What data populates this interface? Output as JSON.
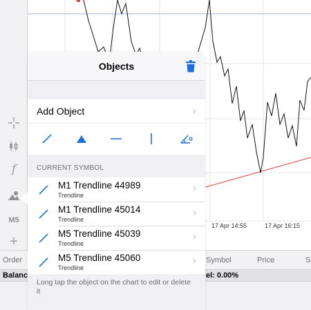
{
  "colors": {
    "accent": "#1a6fe0",
    "trendline": "#e53935"
  },
  "toolbar": {
    "icons": [
      "crosshair-icon",
      "candles-icon",
      "indicators-icon",
      "objects-icon"
    ],
    "indicators_glyph": "f",
    "timeframe": "M5",
    "add_glyph": "+"
  },
  "chart": {
    "time_labels": [
      "17 Apr 14:55",
      "17 Apr 16:15"
    ]
  },
  "trade_table": {
    "columns": [
      "Order",
      "Symbol",
      "Price",
      "S"
    ],
    "balance_label": "Balance",
    "level_text": "el: 0.00%"
  },
  "objects_panel": {
    "title": "Objects",
    "add_object_label": "Add Object",
    "chevron": "›",
    "tool_icons": [
      "trendline-tool-icon",
      "arrow-tool-icon",
      "horizontal-line-tool-icon",
      "vertical-line-tool-icon",
      "angle-tool-icon"
    ],
    "section_header": "CURRENT SYMBOL",
    "objects": [
      {
        "name": "M1 Trendline 44989",
        "type": "Trendline"
      },
      {
        "name": "M1 Trendline 45014",
        "type": "Trendline"
      },
      {
        "name": "M5 Trendline 45039",
        "type": "Trendline"
      },
      {
        "name": "M5 Trendline 45060",
        "type": "Trendline"
      }
    ],
    "footer_note": "Long tap the object on the chart to edit or delete it"
  }
}
